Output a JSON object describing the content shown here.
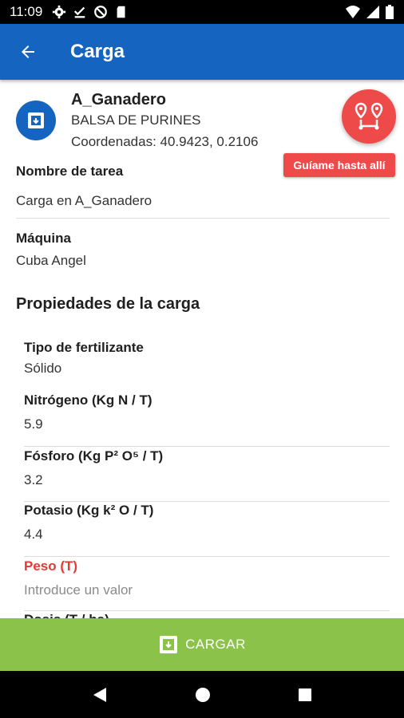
{
  "status_bar": {
    "time": "11:09",
    "left_icons": [
      "gear-icon",
      "check-download-icon",
      "no-disturb-icon",
      "sim-card-icon"
    ],
    "right_icons": [
      "wifi-icon",
      "signal-icon",
      "battery-icon"
    ]
  },
  "app_bar": {
    "back_icon": "arrow-left-icon",
    "title": "Carga"
  },
  "location": {
    "icon": "location-icon",
    "name": "A_Ganadero",
    "type": "BALSA DE PURINES",
    "coordinates": "Coordenadas: 40.9423, 0.2106",
    "nav_icon": "route-icon",
    "guide_label": "Guíame hasta allí"
  },
  "task": {
    "label": "Nombre de tarea",
    "value": "Carga en A_Ganadero"
  },
  "machine": {
    "label": "Máquina",
    "value": "Cuba Angel"
  },
  "properties": {
    "title": "Propiedades de la carga",
    "fertilizer_type": {
      "label": "Tipo de fertilizante",
      "value": "Sólido"
    },
    "nitrogen": {
      "label": "Nitrógeno (Kg N / T)",
      "value": "5.9"
    },
    "phosphorus": {
      "label": "Fósforo (Kg P² O⁵ / T)",
      "value": "3.2"
    },
    "potassium": {
      "label": "Potasio (Kg k² O / T)",
      "value": "4.4"
    },
    "weight": {
      "label": "Peso (T)",
      "placeholder": "Introduce un valor"
    },
    "dose": {
      "label": "Dosis (T / ha)"
    }
  },
  "bottom_button": {
    "icon": "upload-box-icon",
    "label": "CARGAR"
  },
  "nav_bar": [
    "back-triangle-icon",
    "home-circle-icon",
    "recents-square-icon"
  ],
  "colors": {
    "app_bar": "#1565c0",
    "accent_red": "#ef4a4a",
    "required_red": "#e53935",
    "bottom_button": "#8bc34a"
  }
}
